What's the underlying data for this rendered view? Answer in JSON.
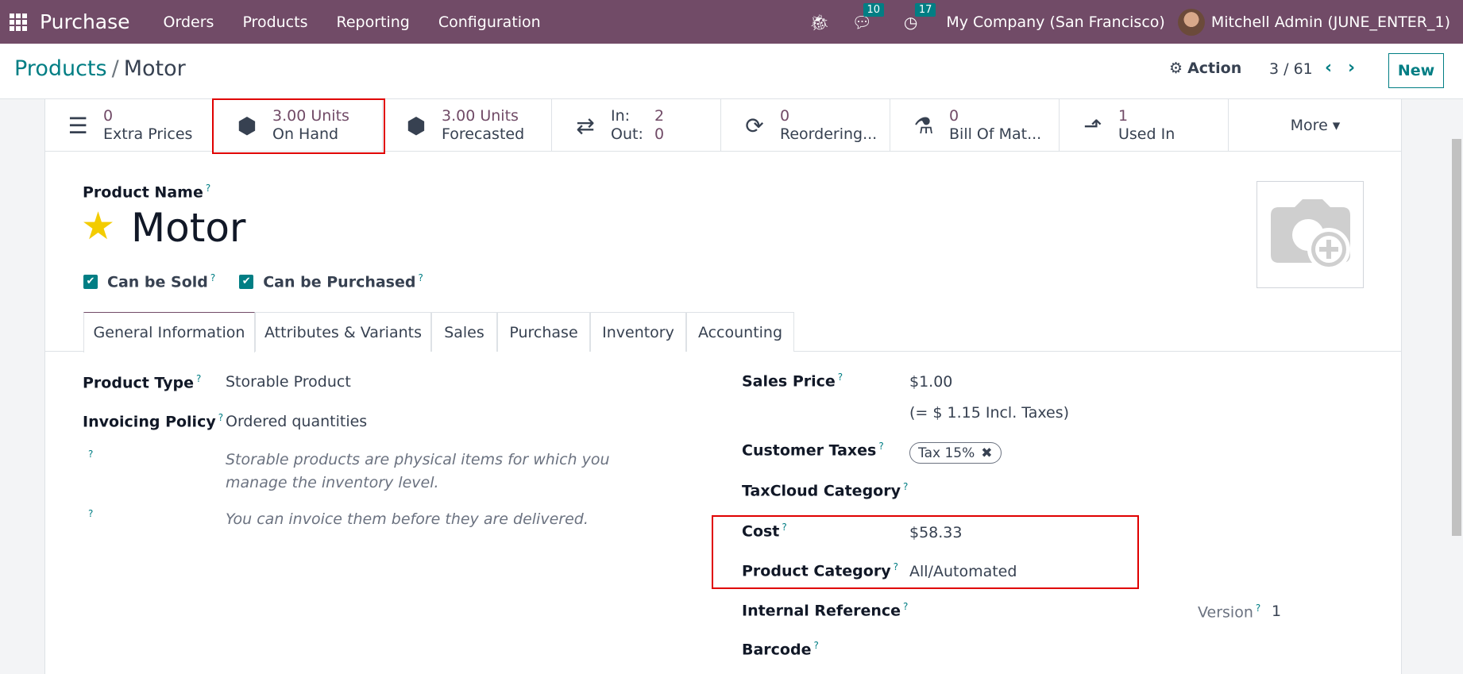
{
  "navbar": {
    "app_name": "Purchase",
    "menu": [
      "Orders",
      "Products",
      "Reporting",
      "Configuration"
    ],
    "messages_count": "10",
    "activities_count": "17",
    "company": "My Company (San Francisco)",
    "user": "Mitchell Admin (JUNE_ENTER_1)"
  },
  "control_panel": {
    "breadcrumb_parent": "Products",
    "breadcrumb_separator": "/",
    "breadcrumb_current": "Motor",
    "action_label": "Action",
    "pager": "3 / 61",
    "new_label": "New"
  },
  "smart_buttons": [
    {
      "value": "0",
      "label": "Extra Prices",
      "icon": "list-icon"
    },
    {
      "value": "3.00 Units",
      "label": "On Hand",
      "icon": "cubes-icon"
    },
    {
      "value": "3.00 Units",
      "label": "Forecasted",
      "icon": "cubes-icon"
    },
    {
      "in_label": "In:",
      "in_value": "2",
      "out_label": "Out:",
      "out_value": "0",
      "icon": "exchange-icon"
    },
    {
      "value": "0",
      "label": "Reordering...",
      "icon": "refresh-icon"
    },
    {
      "value": "0",
      "label": "Bill Of Mat...",
      "icon": "flask-icon"
    },
    {
      "value": "1",
      "label": "Used In",
      "icon": "level-up-icon"
    },
    {
      "label": "More ▾"
    }
  ],
  "product": {
    "name_label": "Product Name",
    "name": "Motor",
    "can_be_sold_label": "Can be Sold",
    "can_be_sold": true,
    "can_be_purchased_label": "Can be Purchased",
    "can_be_purchased": true
  },
  "tabs": [
    "General Information",
    "Attributes & Variants",
    "Sales",
    "Purchase",
    "Inventory",
    "Accounting"
  ],
  "active_tab": "General Information",
  "general": {
    "product_type_label": "Product Type",
    "product_type": "Storable Product",
    "invoicing_policy_label": "Invoicing Policy",
    "invoicing_policy": "Ordered quantities",
    "help_1": "Storable products are physical items for which you manage the inventory level.",
    "help_2": "You can invoice them before they are delivered.",
    "sales_price_label": "Sales Price",
    "sales_price": "$1.00",
    "sales_price_incl": "(= $ 1.15 Incl. Taxes)",
    "customer_taxes_label": "Customer Taxes",
    "customer_tax_tag": "Tax 15%",
    "taxcloud_label": "TaxCloud Category",
    "cost_label": "Cost",
    "cost": "$58.33",
    "category_label": "Product Category",
    "category": "All/Automated",
    "internal_ref_label": "Internal Reference",
    "version_label": "Version",
    "version": "1",
    "barcode_label": "Barcode"
  },
  "help_marker": "?"
}
